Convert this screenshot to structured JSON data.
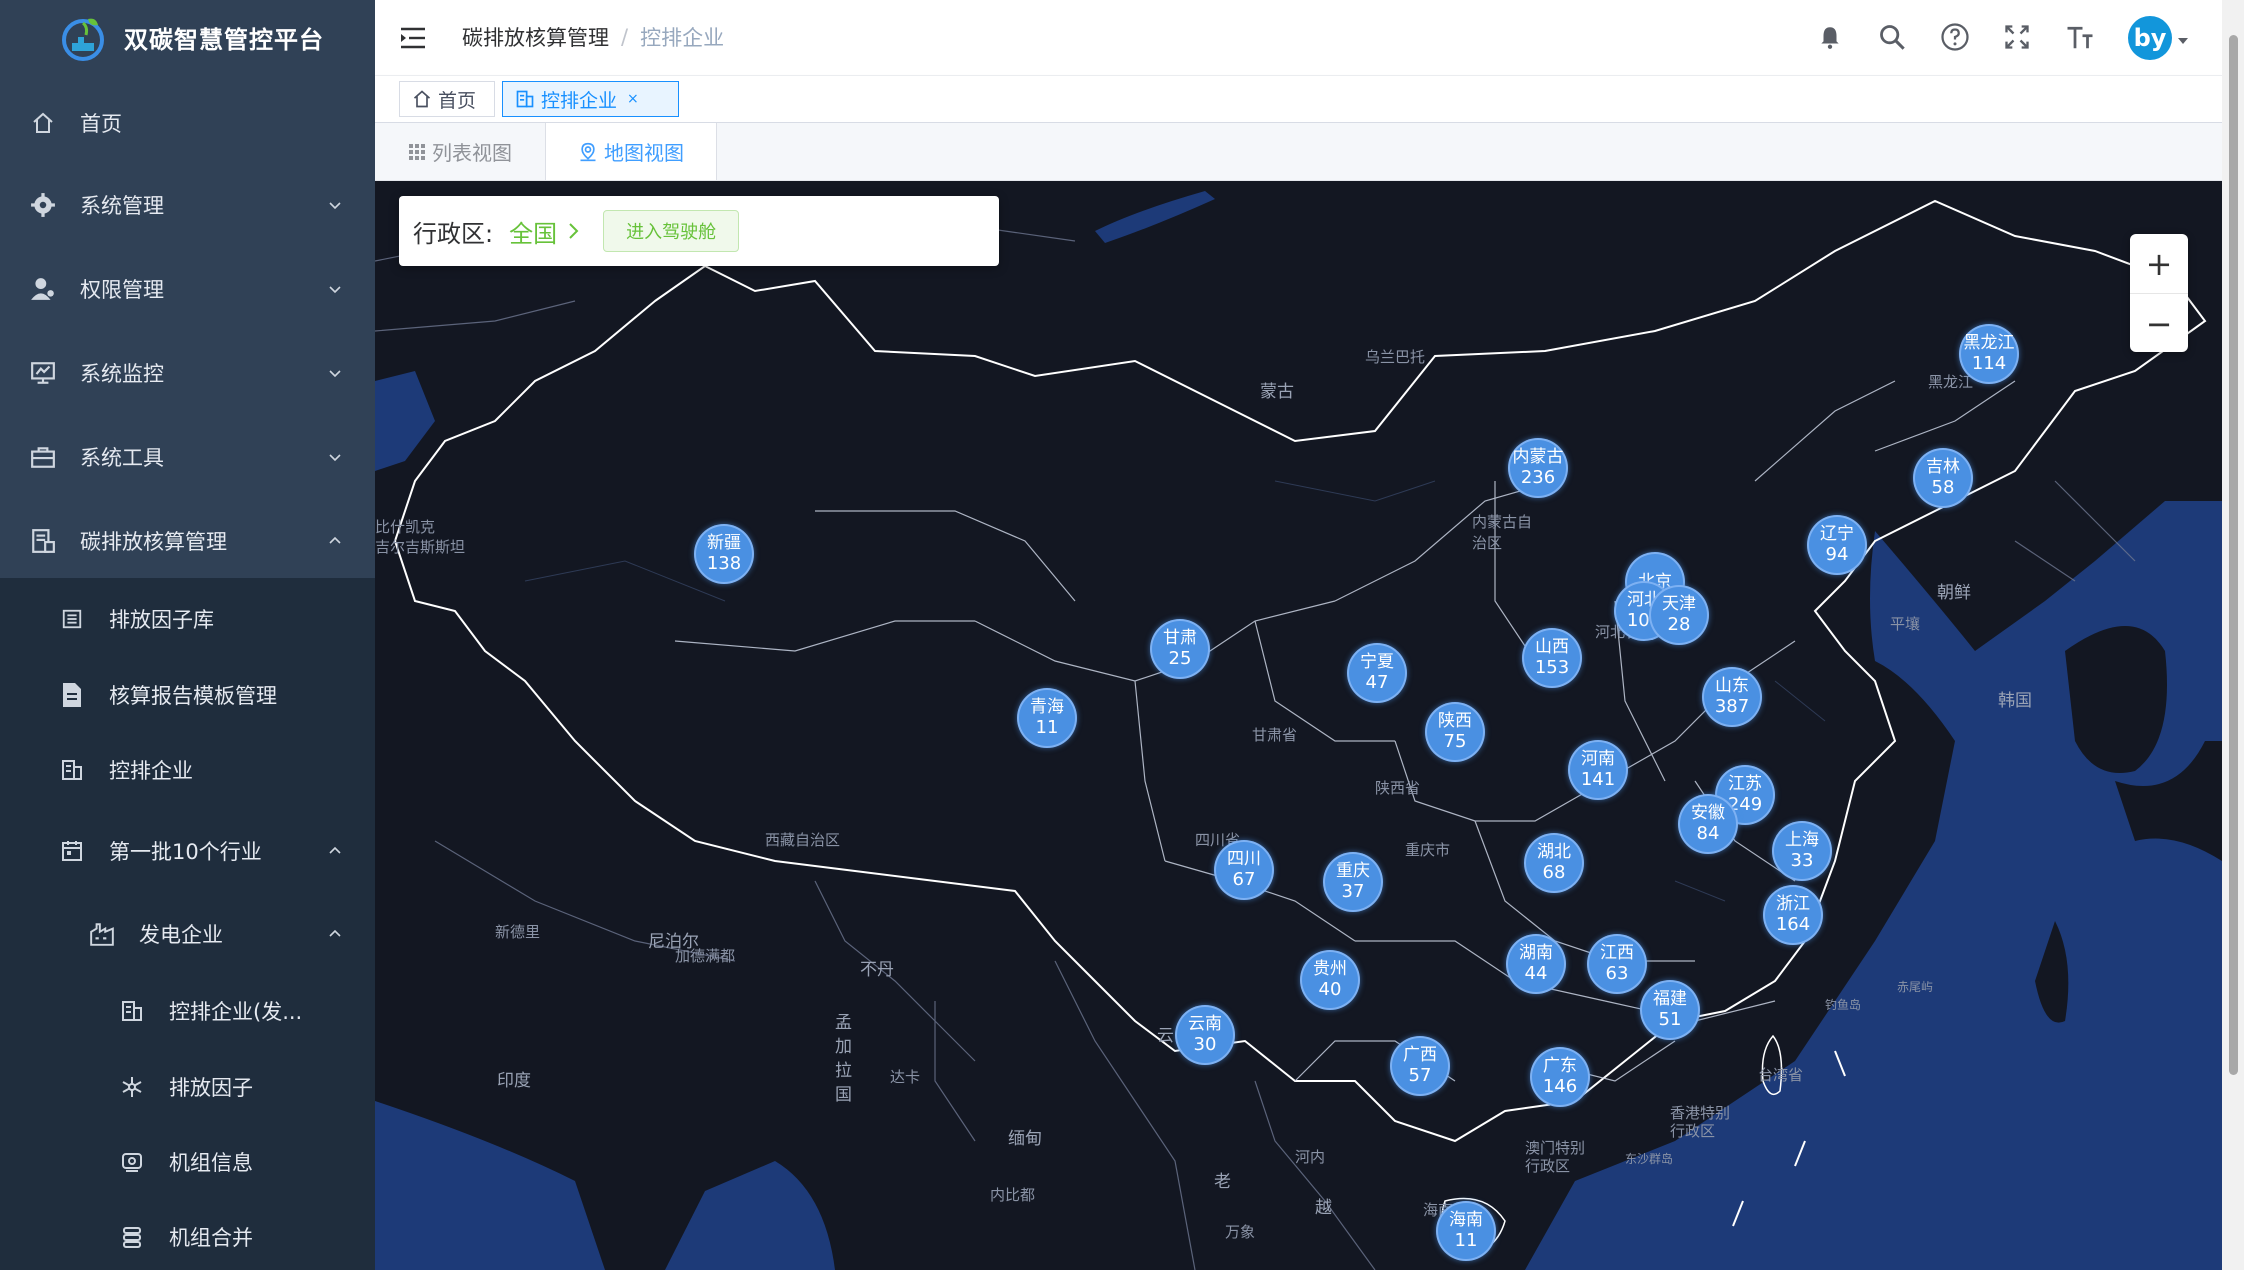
{
  "sidebar": {
    "title": "双碳智慧管控平台",
    "items": [
      {
        "label": "首页",
        "icon": "home-icon"
      },
      {
        "label": "系统管理",
        "icon": "gear-icon"
      },
      {
        "label": "权限管理",
        "icon": "user-icon"
      },
      {
        "label": "系统监控",
        "icon": "monitor-icon"
      },
      {
        "label": "系统工具",
        "icon": "toolbox-icon"
      },
      {
        "label": "碳排放核算管理",
        "icon": "report-icon"
      },
      {
        "label": "排放因子库",
        "icon": "list-icon"
      },
      {
        "label": "核算报告模板管理",
        "icon": "document-icon"
      },
      {
        "label": "控排企业",
        "icon": "building-icon"
      },
      {
        "label": "第一批10个行业",
        "icon": "calendar-icon"
      },
      {
        "label": "发电企业",
        "icon": "factory-icon"
      },
      {
        "label": "控排企业(发...",
        "icon": "building-icon"
      },
      {
        "label": "排放因子",
        "icon": "snowflake-icon"
      },
      {
        "label": "机组信息",
        "icon": "machine-icon"
      },
      {
        "label": "机组合并",
        "icon": "database-icon"
      }
    ]
  },
  "header": {
    "breadcrumb_parent": "碳排放核算管理",
    "breadcrumb_sep": "/",
    "breadcrumb_current": "控排企业",
    "avatar_text": "by"
  },
  "tags": {
    "home": "首页",
    "current": "控排企业",
    "close": "×"
  },
  "views": {
    "list": "列表视图",
    "map": "地图视图"
  },
  "map": {
    "region_label": "行政区:",
    "region_value": "全国",
    "cockpit_button": "进入驾驶舱",
    "zoom_in": "+",
    "zoom_out": "−",
    "provinces": [
      {
        "name": "黑龙江",
        "count": "114"
      },
      {
        "name": "吉林",
        "count": "58"
      },
      {
        "name": "辽宁",
        "count": "94"
      },
      {
        "name": "内蒙古",
        "count": "236"
      },
      {
        "name": "新疆",
        "count": "138"
      },
      {
        "name": "北京",
        "count": ""
      },
      {
        "name": "河北",
        "count": "100"
      },
      {
        "name": "天津",
        "count": "28"
      },
      {
        "name": "甘肃",
        "count": "25"
      },
      {
        "name": "宁夏",
        "count": "47"
      },
      {
        "name": "山西",
        "count": "153"
      },
      {
        "name": "山东",
        "count": "387"
      },
      {
        "name": "青海",
        "count": "11"
      },
      {
        "name": "陕西",
        "count": "75"
      },
      {
        "name": "河南",
        "count": "141"
      },
      {
        "name": "江苏",
        "count": "249"
      },
      {
        "name": "安徽",
        "count": "84"
      },
      {
        "name": "上海",
        "count": "33"
      },
      {
        "name": "湖北",
        "count": "68"
      },
      {
        "name": "四川",
        "count": "67"
      },
      {
        "name": "重庆",
        "count": "37"
      },
      {
        "name": "浙江",
        "count": "164"
      },
      {
        "name": "湖南",
        "count": "44"
      },
      {
        "name": "江西",
        "count": "63"
      },
      {
        "name": "贵州",
        "count": "40"
      },
      {
        "name": "福建",
        "count": "51"
      },
      {
        "name": "云南",
        "count": "30"
      },
      {
        "name": "广西",
        "count": "57"
      },
      {
        "name": "广东",
        "count": "146"
      },
      {
        "name": "海南",
        "count": "11"
      }
    ],
    "labels": [
      "蒙古",
      "乌兰巴托",
      "黑龙江",
      "内蒙古自治区",
      "朝鲜",
      "平壤",
      "韩国",
      "河北省",
      "甘肃省",
      "陕西省",
      "四川省",
      "重庆市",
      "西藏自治区",
      "尼泊尔",
      "加德满都",
      "新德里",
      "不丹",
      "孟加拉国",
      "达卡",
      "印度",
      "缅甸",
      "内比都",
      "老",
      "河内",
      "万象",
      "越",
      "台湾省",
      "香港特别行政区",
      "澳门特别行政区",
      "东沙群岛",
      "钓鱼岛",
      "赤尾屿",
      "吉尔吉斯斯坦",
      "比什凯克",
      "海南省",
      "云"
    ]
  }
}
